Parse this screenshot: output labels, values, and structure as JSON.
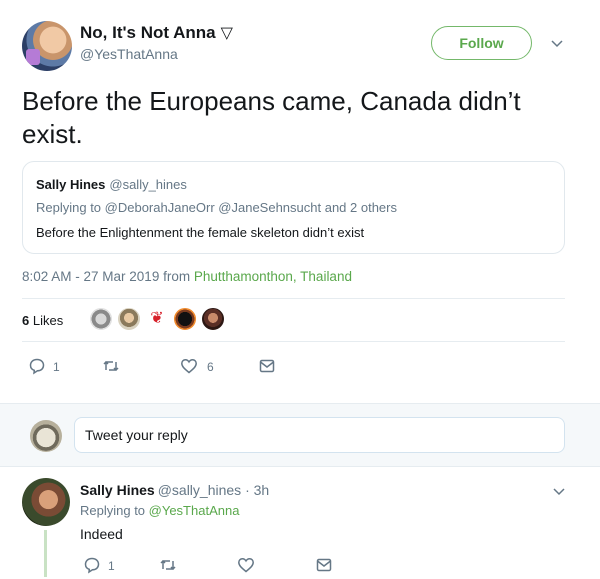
{
  "tweet": {
    "display_name": "No, It's Not Anna",
    "name_icon": "triangle-down-icon",
    "handle": "@YesThatAnna",
    "follow_label": "Follow",
    "text": "Before the Europeans came,  Canada didn’t exist.",
    "quoted": {
      "name": "Sally Hines",
      "handle": "@sally_hines",
      "replying": "Replying to @DeborahJaneOrr @JaneSehnsucht and 2 others",
      "text": "Before the Enlightenment the female skeleton didn’t exist"
    },
    "timestamp": "8:02 AM - 27 Mar 2019 from ",
    "place": "Phutthamonthon, Thailand",
    "likes_number": "6",
    "likes_label": " Likes",
    "actions": {
      "reply_count": "1",
      "retweet_count": "",
      "like_count": "6"
    }
  },
  "reply_box": {
    "placeholder": "Tweet your reply"
  },
  "reply": {
    "name": "Sally Hines",
    "handle": "@sally_hines · 3h",
    "replying_prefix": "Replying to ",
    "replying_to": "@YesThatAnna",
    "text": "Indeed",
    "reply_count": "1"
  },
  "colors": {
    "accent": "#5aa84c",
    "secondary_text": "#657786",
    "divider": "#e6ecf0"
  }
}
